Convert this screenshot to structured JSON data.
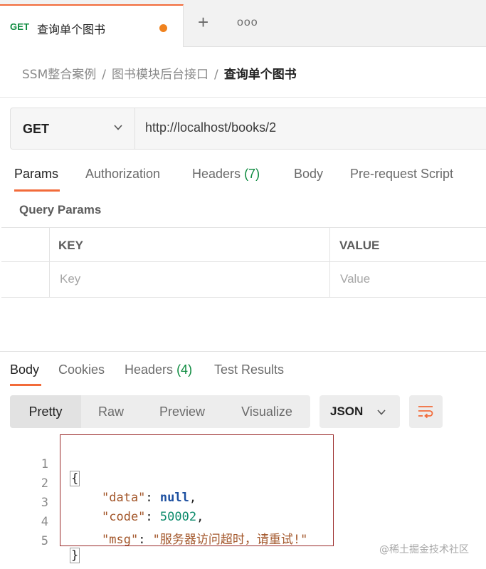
{
  "tab": {
    "method": "GET",
    "title": "查询单个图书",
    "add_label": "+",
    "more_label": "ooo"
  },
  "breadcrumb": {
    "items": [
      "SSM整合案例",
      "图书模块后台接口"
    ],
    "separator": "/",
    "current": "查询单个图书"
  },
  "request": {
    "method": "GET",
    "url": "http://localhost/books/2"
  },
  "request_tabs": {
    "params": "Params",
    "authorization": "Authorization",
    "headers": "Headers",
    "headers_count": "(7)",
    "body": "Body",
    "prerequest": "Pre-request Script"
  },
  "query_params": {
    "label": "Query Params",
    "key_header": "KEY",
    "value_header": "VALUE",
    "key_placeholder": "Key",
    "value_placeholder": "Value"
  },
  "response_tabs": {
    "body": "Body",
    "cookies": "Cookies",
    "headers": "Headers",
    "headers_count": "(4)",
    "test_results": "Test Results"
  },
  "view_modes": {
    "pretty": "Pretty",
    "raw": "Raw",
    "preview": "Preview",
    "visualize": "Visualize"
  },
  "format": "JSON",
  "code": {
    "line_numbers": [
      "1",
      "2",
      "3",
      "4",
      "5"
    ],
    "open_brace": "{",
    "close_brace": "}",
    "data_key": "\"data\"",
    "data_value": "null",
    "code_key": "\"code\"",
    "code_value": "50002",
    "msg_key": "\"msg\"",
    "msg_value": "\"服务器访问超时，请重试!\"",
    "colon": ": ",
    "comma": ","
  },
  "watermark": "@稀土掘金技术社区",
  "colors": {
    "accent": "#f26b3a",
    "unsaved_dot": "#f0821e",
    "get_method": "#0c8a3e",
    "highlight_box": "#9a2a2a"
  }
}
